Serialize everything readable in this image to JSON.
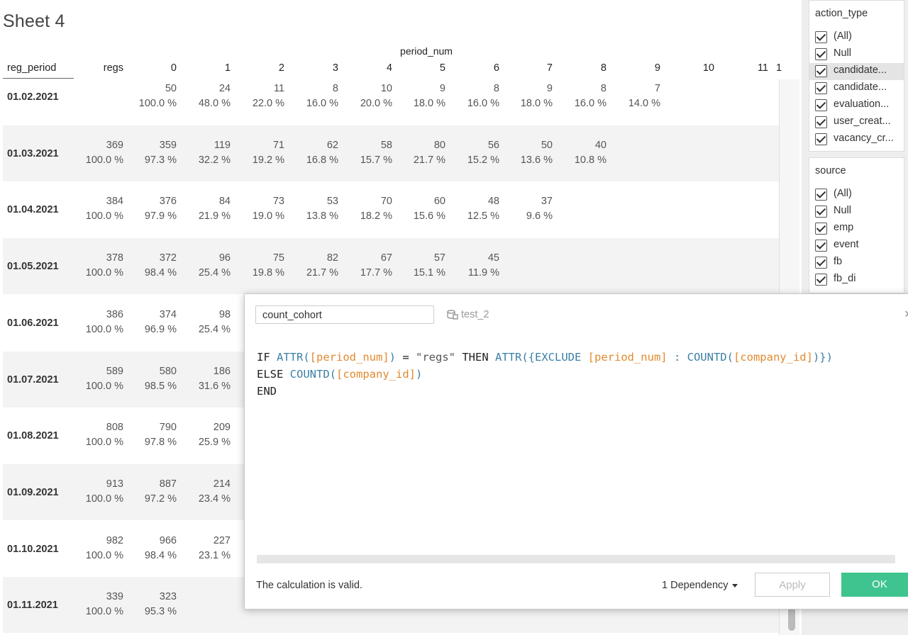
{
  "sheet_title": "Sheet 4",
  "column_group_label": "period_num",
  "row_header": "reg_period",
  "columns": [
    "regs",
    "0",
    "1",
    "2",
    "3",
    "4",
    "5",
    "6",
    "7",
    "8",
    "9",
    "10",
    "11",
    "1"
  ],
  "rows": [
    {
      "date": "01.02.2021",
      "regs": {
        "v": "",
        "p": ""
      },
      "cells": [
        [
          "50",
          "100.0 %"
        ],
        [
          "24",
          "48.0 %"
        ],
        [
          "11",
          "22.0 %"
        ],
        [
          "8",
          "16.0 %"
        ],
        [
          "10",
          "20.0 %"
        ],
        [
          "9",
          "18.0 %"
        ],
        [
          "8",
          "16.0 %"
        ],
        [
          "9",
          "18.0 %"
        ],
        [
          "8",
          "16.0 %"
        ],
        [
          "7",
          "14.0 %"
        ]
      ]
    },
    {
      "date": "01.03.2021",
      "regs": {
        "v": "369",
        "p": "100.0 %"
      },
      "cells": [
        [
          "359",
          "97.3 %"
        ],
        [
          "119",
          "32.2 %"
        ],
        [
          "71",
          "19.2 %"
        ],
        [
          "62",
          "16.8 %"
        ],
        [
          "58",
          "15.7 %"
        ],
        [
          "80",
          "21.7 %"
        ],
        [
          "56",
          "15.2 %"
        ],
        [
          "50",
          "13.6 %"
        ],
        [
          "40",
          "10.8 %"
        ]
      ]
    },
    {
      "date": "01.04.2021",
      "regs": {
        "v": "384",
        "p": "100.0 %"
      },
      "cells": [
        [
          "376",
          "97.9 %"
        ],
        [
          "84",
          "21.9 %"
        ],
        [
          "73",
          "19.0 %"
        ],
        [
          "53",
          "13.8 %"
        ],
        [
          "70",
          "18.2 %"
        ],
        [
          "60",
          "15.6 %"
        ],
        [
          "48",
          "12.5 %"
        ],
        [
          "37",
          "9.6 %"
        ]
      ]
    },
    {
      "date": "01.05.2021",
      "regs": {
        "v": "378",
        "p": "100.0 %"
      },
      "cells": [
        [
          "372",
          "98.4 %"
        ],
        [
          "96",
          "25.4 %"
        ],
        [
          "75",
          "19.8 %"
        ],
        [
          "82",
          "21.7 %"
        ],
        [
          "67",
          "17.7 %"
        ],
        [
          "57",
          "15.1 %"
        ],
        [
          "45",
          "11.9 %"
        ]
      ]
    },
    {
      "date": "01.06.2021",
      "regs": {
        "v": "386",
        "p": "100.0 %"
      },
      "cells": [
        [
          "374",
          "96.9 %"
        ],
        [
          "98",
          "25.4 %"
        ]
      ]
    },
    {
      "date": "01.07.2021",
      "regs": {
        "v": "589",
        "p": "100.0 %"
      },
      "cells": [
        [
          "580",
          "98.5 %"
        ],
        [
          "186",
          "31.6 %"
        ]
      ]
    },
    {
      "date": "01.08.2021",
      "regs": {
        "v": "808",
        "p": "100.0 %"
      },
      "cells": [
        [
          "790",
          "97.8 %"
        ],
        [
          "209",
          "25.9 %"
        ]
      ]
    },
    {
      "date": "01.09.2021",
      "regs": {
        "v": "913",
        "p": "100.0 %"
      },
      "cells": [
        [
          "887",
          "97.2 %"
        ],
        [
          "214",
          "23.4 %"
        ]
      ]
    },
    {
      "date": "01.10.2021",
      "regs": {
        "v": "982",
        "p": "100.0 %"
      },
      "cells": [
        [
          "966",
          "98.4 %"
        ],
        [
          "227",
          "23.1 %"
        ]
      ]
    },
    {
      "date": "01.11.2021",
      "regs": {
        "v": "339",
        "p": "100.0 %"
      },
      "cells": [
        [
          "323",
          "95.3 %"
        ]
      ]
    }
  ],
  "filters": [
    {
      "title": "action_type",
      "items": [
        {
          "label": "(All)",
          "checked": true,
          "selected": false
        },
        {
          "label": "Null",
          "checked": true,
          "selected": false
        },
        {
          "label": "candidate...",
          "checked": true,
          "selected": true
        },
        {
          "label": "candidate...",
          "checked": true,
          "selected": false
        },
        {
          "label": "evaluation...",
          "checked": true,
          "selected": false
        },
        {
          "label": "user_creat...",
          "checked": true,
          "selected": false
        },
        {
          "label": "vacancy_cr...",
          "checked": true,
          "selected": false
        }
      ]
    },
    {
      "title": "source",
      "items": [
        {
          "label": "(All)",
          "checked": true,
          "selected": false
        },
        {
          "label": "Null",
          "checked": true,
          "selected": false
        },
        {
          "label": "emp",
          "checked": true,
          "selected": false
        },
        {
          "label": "event",
          "checked": true,
          "selected": false
        },
        {
          "label": "fb",
          "checked": true,
          "selected": false
        },
        {
          "label": "fb_di",
          "checked": true,
          "selected": false
        }
      ]
    }
  ],
  "dialog": {
    "calc_name": "count_cohort",
    "datasource": "test_2",
    "code_lines": [
      [
        [
          "kw",
          "IF "
        ],
        [
          "fn",
          "ATTR("
        ],
        [
          "fld",
          "[period_num]"
        ],
        [
          "fn",
          ")"
        ],
        [
          "kw",
          " = "
        ],
        [
          "str",
          "\"regs\""
        ],
        [
          "kw",
          " THEN "
        ],
        [
          "fn",
          "ATTR({EXCLUDE "
        ],
        [
          "fld",
          "[period_num]"
        ],
        [
          "fn",
          " : COUNTD("
        ],
        [
          "fld",
          "[company_id]"
        ],
        [
          "fn",
          ")})"
        ]
      ],
      [
        [
          "kw",
          "ELSE "
        ],
        [
          "fn",
          "COUNTD("
        ],
        [
          "fld",
          "[company_id]"
        ],
        [
          "fn",
          ")"
        ]
      ],
      [
        [
          "kw",
          "END"
        ]
      ]
    ],
    "status": "The calculation is valid.",
    "dependency_label": "1 Dependency",
    "apply_label": "Apply",
    "ok_label": "OK",
    "ok_color": "#3fc48f"
  }
}
